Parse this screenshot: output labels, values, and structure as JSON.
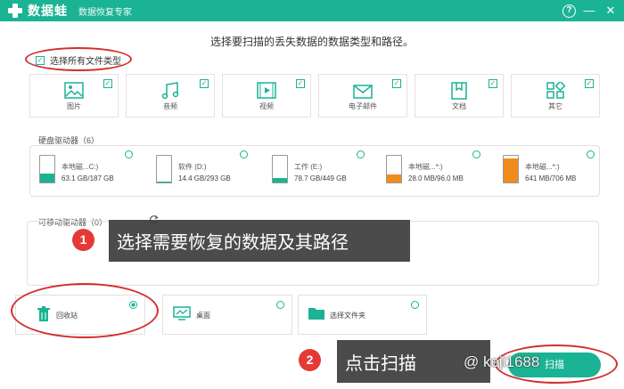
{
  "titlebar": {
    "app_name": "数据蛙",
    "subtitle": "数据恢复专家",
    "help": "?",
    "minimize": "—",
    "close": "✕"
  },
  "heading": "选择要扫描的丢失数据的数据类型和路径。",
  "select_all": {
    "label": "选择所有文件类型",
    "checked": true
  },
  "file_types": [
    {
      "label": "图片",
      "icon": "image-icon",
      "checked": true
    },
    {
      "label": "音频",
      "icon": "music-icon",
      "checked": true
    },
    {
      "label": "视频",
      "icon": "video-icon",
      "checked": true
    },
    {
      "label": "电子邮件",
      "icon": "email-icon",
      "checked": true
    },
    {
      "label": "文档",
      "icon": "document-icon",
      "checked": true
    },
    {
      "label": "其它",
      "icon": "other-icon",
      "checked": true
    }
  ],
  "hard_drives": {
    "title": "硬盘驱动器（6）",
    "drives": [
      {
        "name": "本地磁...C:)",
        "size": "63.1 GB/187 GB",
        "usage": 0.34,
        "color": "#1ab394"
      },
      {
        "name": "软件 (D:)",
        "size": "14.4 GB/293 GB",
        "usage": 0.05,
        "color": "#1ab394"
      },
      {
        "name": "工作 (E:)",
        "size": "78.7 GB/449 GB",
        "usage": 0.18,
        "color": "#1ab394"
      },
      {
        "name": "本地磁...*:)",
        "size": "28.0 MB/96.0 MB",
        "usage": 0.29,
        "color": "#f28b1e"
      },
      {
        "name": "本地磁...*:)",
        "size": "641 MB/706 MB",
        "usage": 0.91,
        "color": "#f28b1e"
      }
    ]
  },
  "removable": {
    "title": "可移动驱动器（0）"
  },
  "locations": [
    {
      "label": "回收站",
      "icon": "trash-icon",
      "selected": true
    },
    {
      "label": "桌面",
      "icon": "desktop-icon",
      "selected": false
    },
    {
      "label": "选择文件夹",
      "icon": "folder-icon",
      "selected": false
    }
  ],
  "callouts": [
    {
      "badge": "1",
      "text": "选择需要恢复的数据及其路径"
    },
    {
      "badge": "2",
      "text": "点击扫描"
    }
  ],
  "scan_button": "扫描",
  "watermark": "@ keji1688",
  "colors": {
    "accent": "#1ab394",
    "annotation": "#d32f2f",
    "warning": "#f28b1e"
  }
}
